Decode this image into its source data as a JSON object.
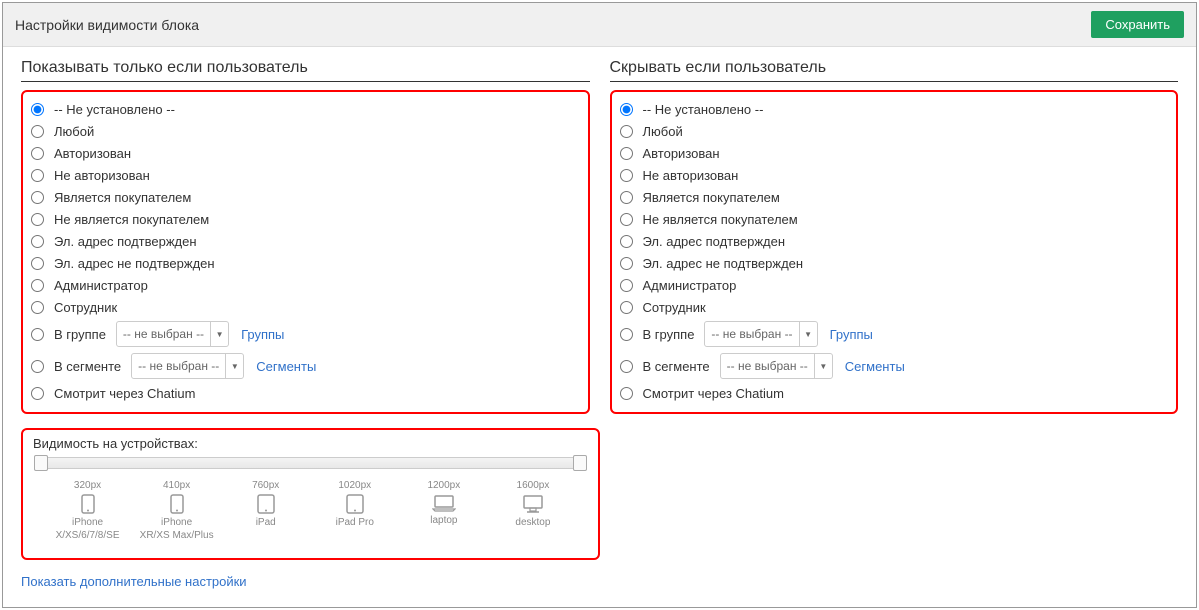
{
  "header": {
    "title": "Настройки видимости блока",
    "save": "Сохранить"
  },
  "show": {
    "title": "Показывать только если пользователь",
    "options": [
      "-- Не установлено --",
      "Любой",
      "Авторизован",
      "Не авторизован",
      "Является покупателем",
      "Не является покупателем",
      "Эл. адрес подтвержден",
      "Эл. адрес не подтвержден",
      "Администратор",
      "Сотрудник"
    ],
    "group_label": "В группе",
    "group_value": "-- не выбран --",
    "group_link": "Группы",
    "segment_label": "В сегменте",
    "segment_value": "-- не выбран --",
    "segment_link": "Сегменты",
    "chatium": "Смотрит через Chatium",
    "selected_index": 0
  },
  "hide": {
    "title": "Скрывать если пользователь",
    "options": [
      "-- Не установлено --",
      "Любой",
      "Авторизован",
      "Не авторизован",
      "Является покупателем",
      "Не является покупателем",
      "Эл. адрес подтвержден",
      "Эл. адрес не подтвержден",
      "Администратор",
      "Сотрудник"
    ],
    "group_label": "В группе",
    "group_value": "-- не выбран --",
    "group_link": "Группы",
    "segment_label": "В сегменте",
    "segment_value": "-- не выбран --",
    "segment_link": "Сегменты",
    "chatium": "Смотрит через Chatium",
    "selected_index": 0
  },
  "devices": {
    "title": "Видимость на устройствах:",
    "items": [
      {
        "px": "320px",
        "name": "iPhone\nX/XS/6/7/8/SE",
        "icon": "phone"
      },
      {
        "px": "410px",
        "name": "iPhone\nXR/XS Max/Plus",
        "icon": "phone"
      },
      {
        "px": "760px",
        "name": "iPad",
        "icon": "tablet"
      },
      {
        "px": "1020px",
        "name": "iPad Pro",
        "icon": "tablet"
      },
      {
        "px": "1200px",
        "name": "laptop",
        "icon": "laptop"
      },
      {
        "px": "1600px",
        "name": "desktop",
        "icon": "desktop"
      }
    ]
  },
  "footer": {
    "more": "Показать дополнительные настройки"
  }
}
